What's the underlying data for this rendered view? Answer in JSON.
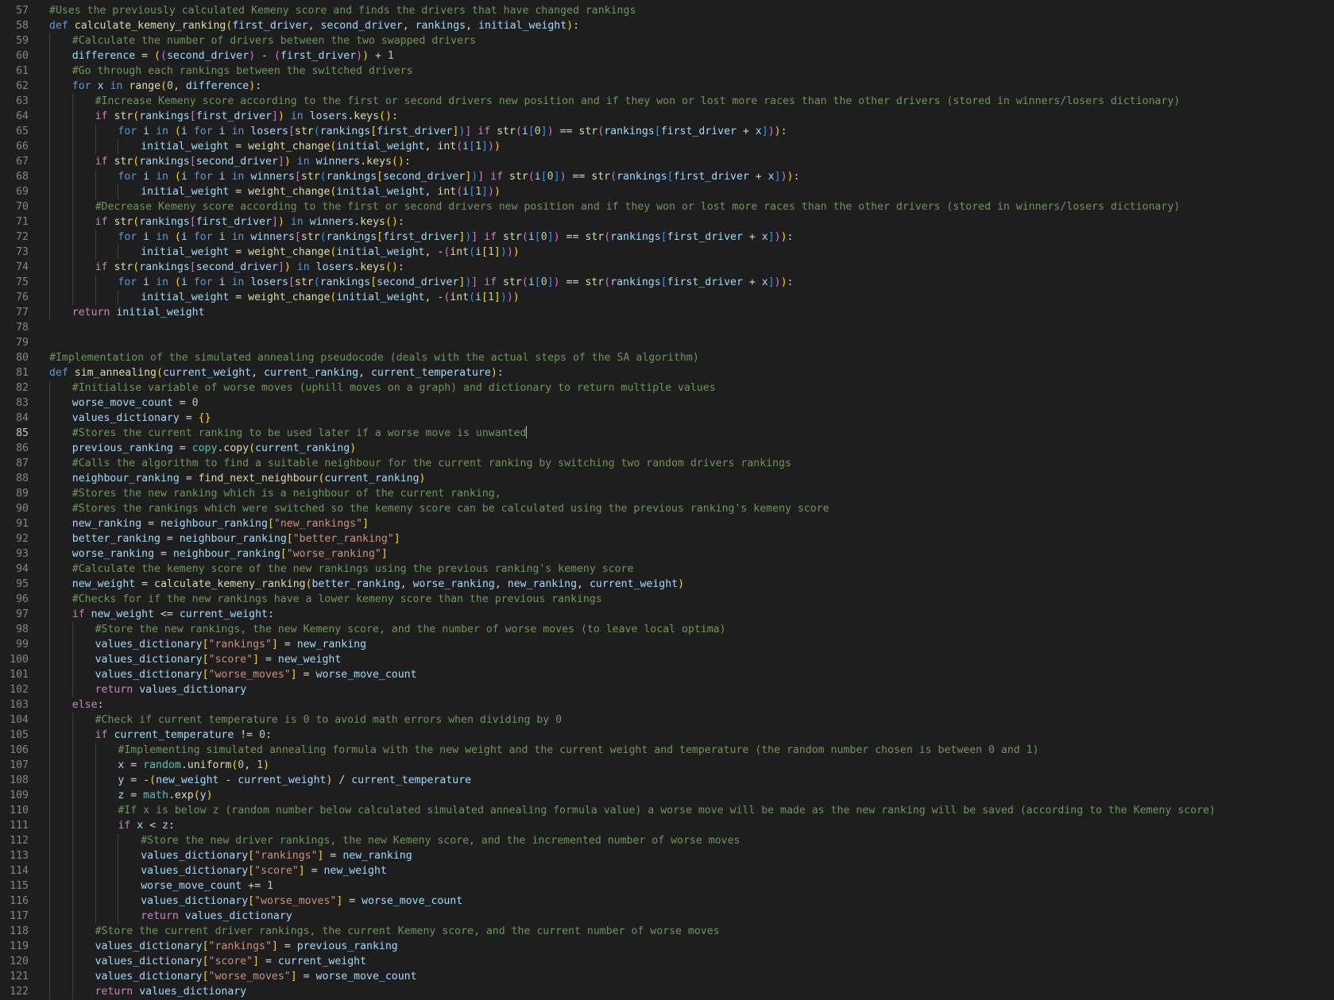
{
  "editor": {
    "cursor_line": 85,
    "colors": {
      "background": "#1e1e1e",
      "line_number": "#858585",
      "keyword": "#569cd6",
      "control": "#c586c0",
      "function": "#dcdcaa",
      "variable": "#9cdcfe",
      "string": "#ce9178",
      "number": "#b5cea8",
      "comment": "#6a9955",
      "bracket_1": "#ffd700",
      "bracket_2": "#da70d6",
      "bracket_3": "#179fff"
    },
    "lines": [
      {
        "num": "57",
        "indent": 0,
        "text": "#Uses the previously calculated Kemeny score and finds the drivers that have changed rankings"
      },
      {
        "num": "58",
        "indent": 0,
        "text": "def calculate_kemeny_ranking(first_driver, second_driver, rankings, initial_weight):"
      },
      {
        "num": "59",
        "indent": 1,
        "text": "#Calculate the number of drivers between the two swapped drivers"
      },
      {
        "num": "60",
        "indent": 1,
        "text": "difference = ((second_driver) - (first_driver)) + 1"
      },
      {
        "num": "61",
        "indent": 1,
        "text": "#Go through each rankings between the switched drivers"
      },
      {
        "num": "62",
        "indent": 1,
        "text": "for x in range(0, difference):"
      },
      {
        "num": "63",
        "indent": 2,
        "text": "#Increase Kemeny score according to the first or second drivers new position and if they won or lost more races than the other drivers (stored in winners/losers dictionary)"
      },
      {
        "num": "64",
        "indent": 2,
        "text": "if str(rankings[first_driver]) in losers.keys():"
      },
      {
        "num": "65",
        "indent": 3,
        "text": "for i in (i for i in losers[str(rankings[first_driver])] if str(i[0]) == str(rankings[first_driver + x])):"
      },
      {
        "num": "66",
        "indent": 4,
        "text": "initial_weight = weight_change(initial_weight, int(i[1]))"
      },
      {
        "num": "67",
        "indent": 2,
        "text": "if str(rankings[second_driver]) in winners.keys():"
      },
      {
        "num": "68",
        "indent": 3,
        "text": "for i in (i for i in winners[str(rankings[second_driver])] if str(i[0]) == str(rankings[first_driver + x])):"
      },
      {
        "num": "69",
        "indent": 4,
        "text": "initial_weight = weight_change(initial_weight, int(i[1]))"
      },
      {
        "num": "70",
        "indent": 2,
        "text": "#Decrease Kemeny score according to the first or second drivers new position and if they won or lost more races than the other drivers (stored in winners/losers dictionary)"
      },
      {
        "num": "71",
        "indent": 2,
        "text": "if str(rankings[first_driver]) in winners.keys():"
      },
      {
        "num": "72",
        "indent": 3,
        "text": "for i in (i for i in winners[str(rankings[first_driver])] if str(i[0]) == str(rankings[first_driver + x])):"
      },
      {
        "num": "73",
        "indent": 4,
        "text": "initial_weight = weight_change(initial_weight, -(int(i[1])))"
      },
      {
        "num": "74",
        "indent": 2,
        "text": "if str(rankings[second_driver]) in losers.keys():"
      },
      {
        "num": "75",
        "indent": 3,
        "text": "for i in (i for i in losers[str(rankings[second_driver])] if str(i[0]) == str(rankings[first_driver + x])):"
      },
      {
        "num": "76",
        "indent": 4,
        "text": "initial_weight = weight_change(initial_weight, -(int(i[1])))"
      },
      {
        "num": "77",
        "indent": 1,
        "text": "return initial_weight"
      },
      {
        "num": "78",
        "indent": 0,
        "text": ""
      },
      {
        "num": "79",
        "indent": 0,
        "text": ""
      },
      {
        "num": "80",
        "indent": 0,
        "text": "#Implementation of the simulated annealing pseudocode (deals with the actual steps of the SA algorithm)"
      },
      {
        "num": "81",
        "indent": 0,
        "text": "def sim_annealing(current_weight, current_ranking, current_temperature):"
      },
      {
        "num": "82",
        "indent": 1,
        "text": "#Initialise variable of worse moves (uphill moves on a graph) and dictionary to return multiple values"
      },
      {
        "num": "83",
        "indent": 1,
        "text": "worse_move_count = 0"
      },
      {
        "num": "84",
        "indent": 1,
        "text": "values_dictionary = {}"
      },
      {
        "num": "85",
        "indent": 1,
        "text": "#Stores the current ranking to be used later if a worse move is unwanted"
      },
      {
        "num": "86",
        "indent": 1,
        "text": "previous_ranking = copy.copy(current_ranking)"
      },
      {
        "num": "87",
        "indent": 1,
        "text": "#Calls the algorithm to find a suitable neighbour for the current ranking by switching two random drivers rankings"
      },
      {
        "num": "88",
        "indent": 1,
        "text": "neighbour_ranking = find_next_neighbour(current_ranking)"
      },
      {
        "num": "89",
        "indent": 1,
        "text": "#Stores the new ranking which is a neighbour of the current ranking,"
      },
      {
        "num": "90",
        "indent": 1,
        "text": "#Stores the rankings which were switched so the kemeny score can be calculated using the previous ranking's kemeny score"
      },
      {
        "num": "91",
        "indent": 1,
        "text": "new_ranking = neighbour_ranking[\"new_rankings\"]"
      },
      {
        "num": "92",
        "indent": 1,
        "text": "better_ranking = neighbour_ranking[\"better_ranking\"]"
      },
      {
        "num": "93",
        "indent": 1,
        "text": "worse_ranking = neighbour_ranking[\"worse_ranking\"]"
      },
      {
        "num": "94",
        "indent": 1,
        "text": "#Calculate the kemeny score of the new rankings using the previous ranking's kemeny score"
      },
      {
        "num": "95",
        "indent": 1,
        "text": "new_weight = calculate_kemeny_ranking(better_ranking, worse_ranking, new_ranking, current_weight)"
      },
      {
        "num": "96",
        "indent": 1,
        "text": "#Checks for if the new rankings have a lower kemeny score than the previous rankings"
      },
      {
        "num": "97",
        "indent": 1,
        "text": "if new_weight <= current_weight:"
      },
      {
        "num": "98",
        "indent": 2,
        "text": "#Store the new rankings, the new Kemeny score, and the number of worse moves (to leave local optima)"
      },
      {
        "num": "99",
        "indent": 2,
        "text": "values_dictionary[\"rankings\"] = new_ranking"
      },
      {
        "num": "100",
        "indent": 2,
        "text": "values_dictionary[\"score\"] = new_weight"
      },
      {
        "num": "101",
        "indent": 2,
        "text": "values_dictionary[\"worse_moves\"] = worse_move_count"
      },
      {
        "num": "102",
        "indent": 2,
        "text": "return values_dictionary"
      },
      {
        "num": "103",
        "indent": 1,
        "text": "else:"
      },
      {
        "num": "104",
        "indent": 2,
        "text": "#Check if current temperature is 0 to avoid math errors when dividing by 0"
      },
      {
        "num": "105",
        "indent": 2,
        "text": "if current_temperature != 0:"
      },
      {
        "num": "106",
        "indent": 3,
        "text": "#Implementing simulated annealing formula with the new weight and the current weight and temperature (the random number chosen is between 0 and 1)"
      },
      {
        "num": "107",
        "indent": 3,
        "text": "x = random.uniform(0, 1)"
      },
      {
        "num": "108",
        "indent": 3,
        "text": "y = -(new_weight - current_weight) / current_temperature"
      },
      {
        "num": "109",
        "indent": 3,
        "text": "z = math.exp(y)"
      },
      {
        "num": "110",
        "indent": 3,
        "text": "#If x is below z (random number below calculated simulated annealing formula value) a worse move will be made as the new ranking will be saved (according to the Kemeny score)"
      },
      {
        "num": "111",
        "indent": 3,
        "text": "if x < z:"
      },
      {
        "num": "112",
        "indent": 4,
        "text": "#Store the new driver rankings, the new Kemeny score, and the incremented number of worse moves"
      },
      {
        "num": "113",
        "indent": 4,
        "text": "values_dictionary[\"rankings\"] = new_ranking"
      },
      {
        "num": "114",
        "indent": 4,
        "text": "values_dictionary[\"score\"] = new_weight"
      },
      {
        "num": "115",
        "indent": 4,
        "text": "worse_move_count += 1"
      },
      {
        "num": "116",
        "indent": 4,
        "text": "values_dictionary[\"worse_moves\"] = worse_move_count"
      },
      {
        "num": "117",
        "indent": 4,
        "text": "return values_dictionary"
      },
      {
        "num": "118",
        "indent": 2,
        "text": "#Store the current driver rankings, the current Kemeny score, and the current number of worse moves"
      },
      {
        "num": "119",
        "indent": 2,
        "text": "values_dictionary[\"rankings\"] = previous_ranking"
      },
      {
        "num": "120",
        "indent": 2,
        "text": "values_dictionary[\"score\"] = current_weight"
      },
      {
        "num": "121",
        "indent": 2,
        "text": "values_dictionary[\"worse_moves\"] = worse_move_count"
      },
      {
        "num": "122",
        "indent": 2,
        "text": "return values_dictionary"
      }
    ]
  }
}
